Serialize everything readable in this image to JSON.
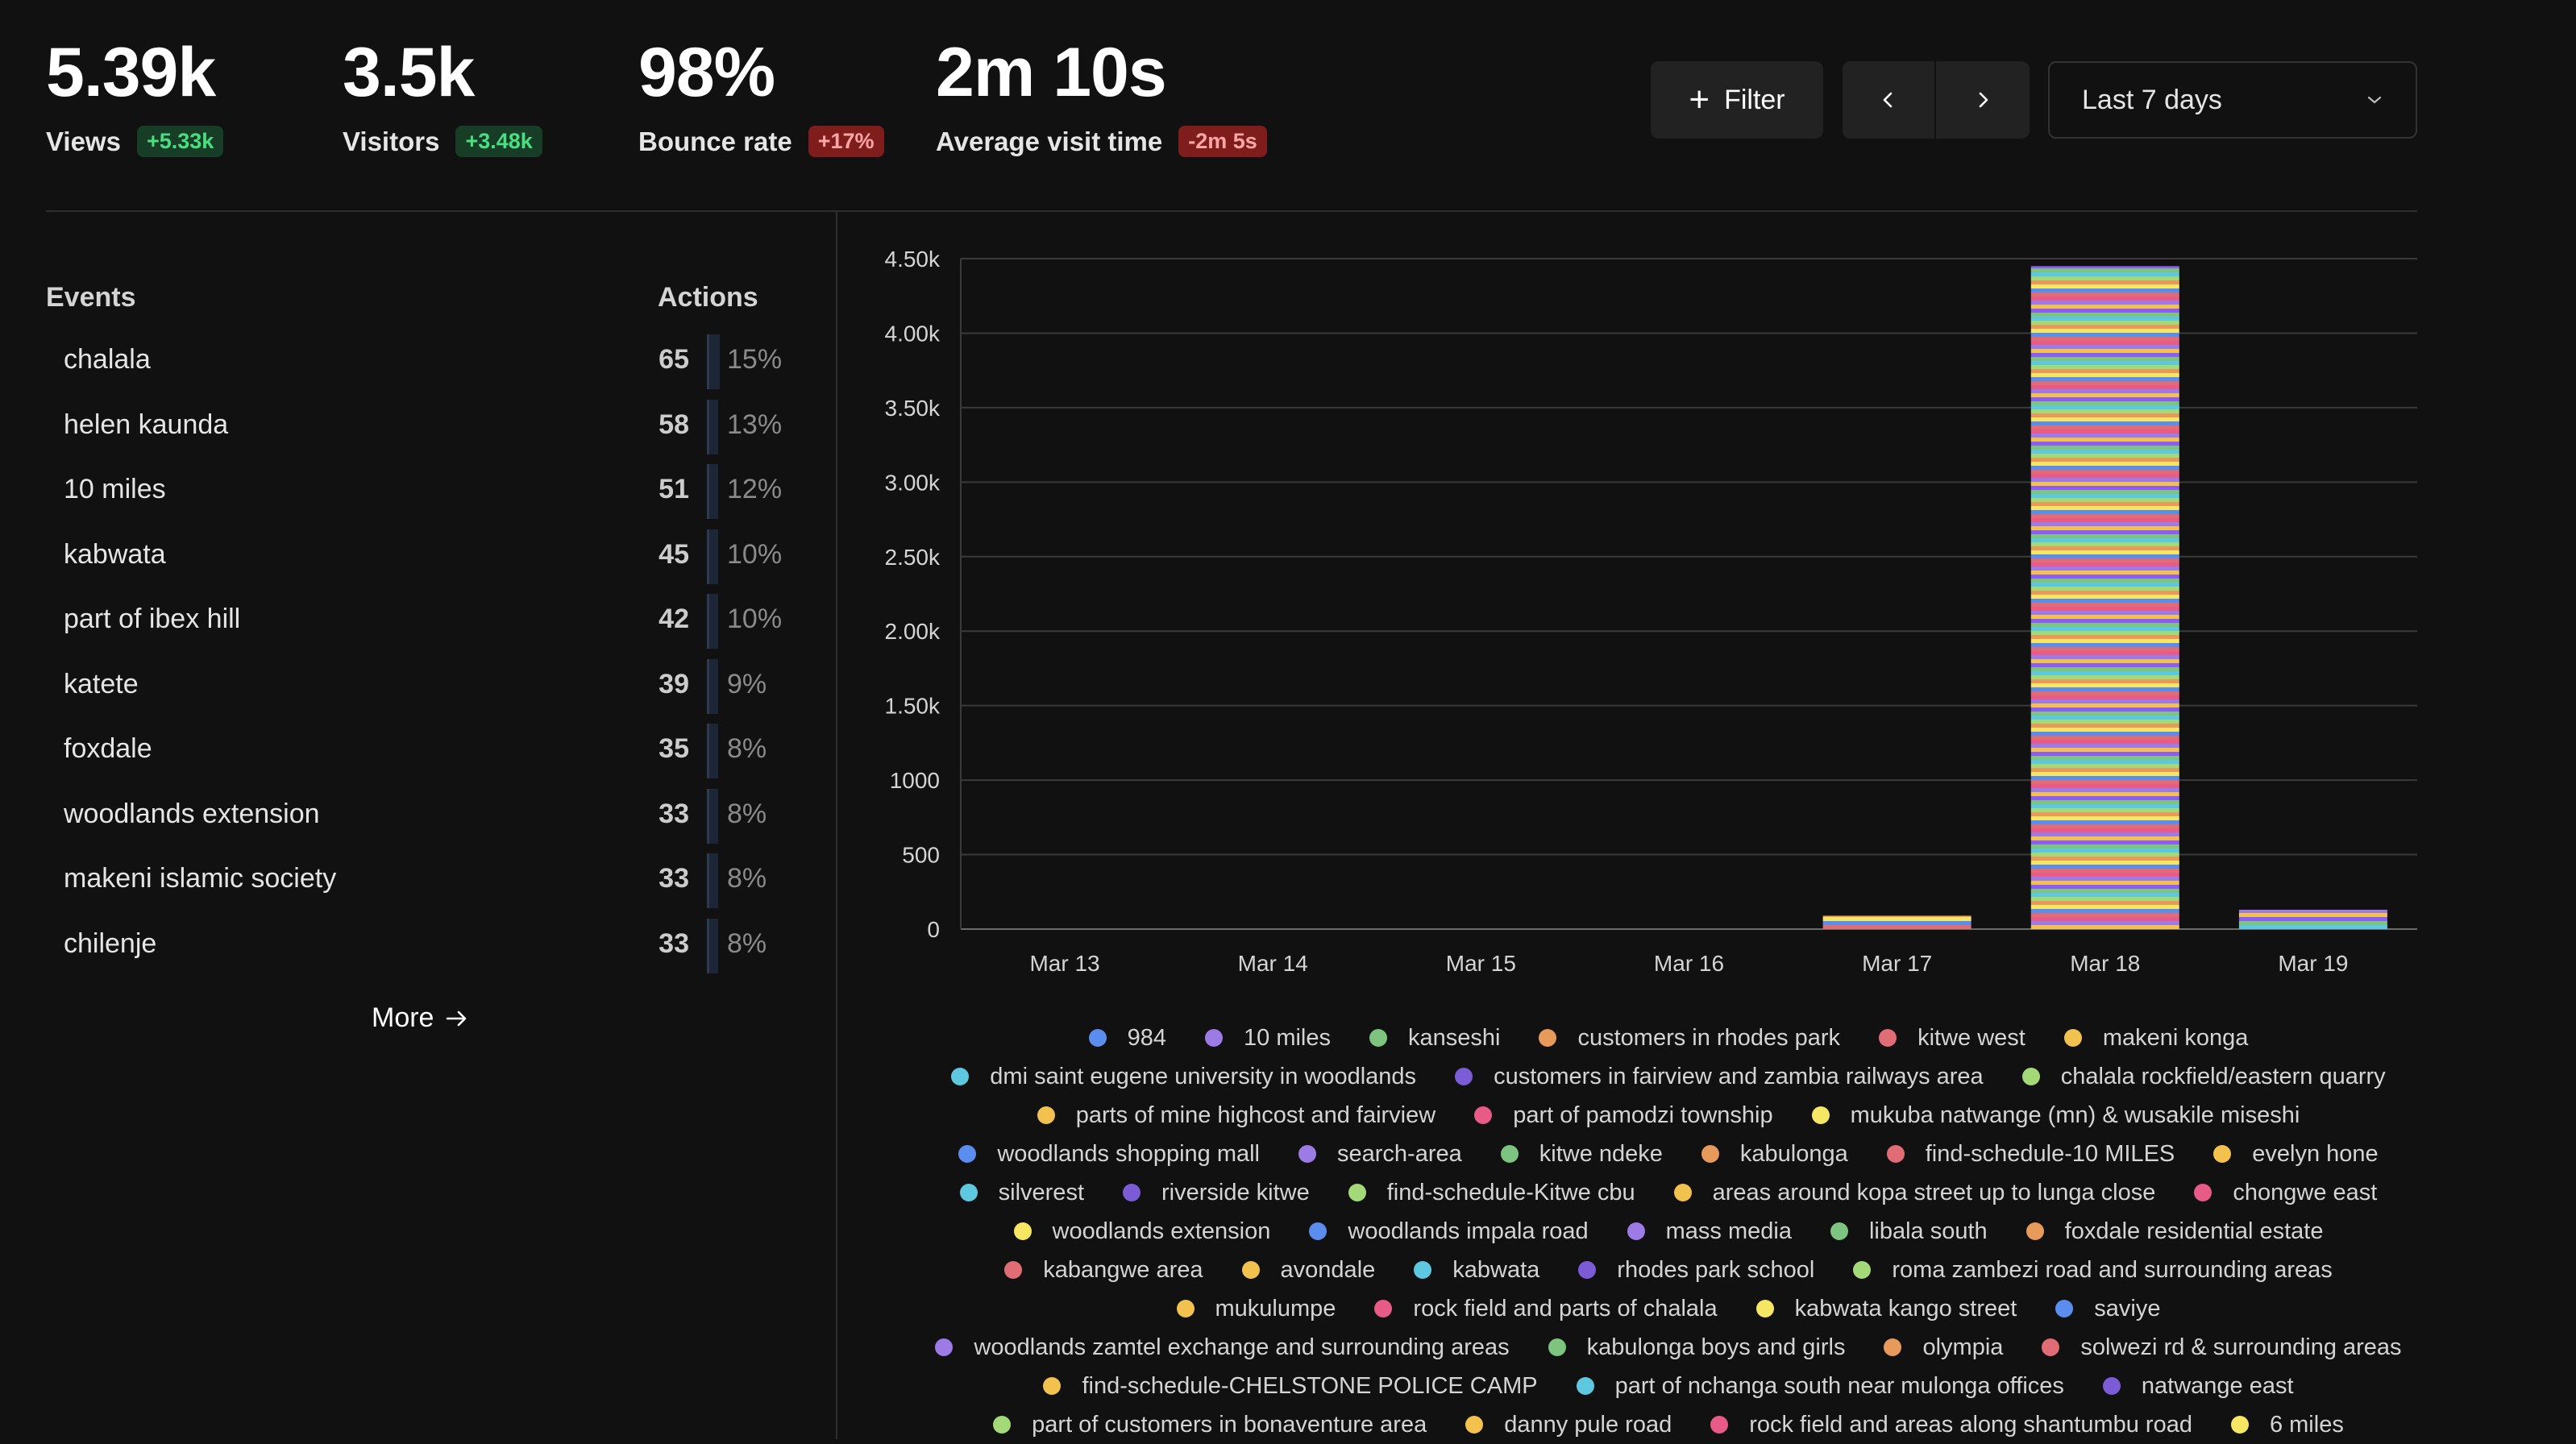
{
  "metrics": [
    {
      "value": "5.39k",
      "label": "Views",
      "badge": "+5.33k",
      "tone": "pos"
    },
    {
      "value": "3.5k",
      "label": "Visitors",
      "badge": "+3.48k",
      "tone": "pos"
    },
    {
      "value": "98%",
      "label": "Bounce rate",
      "badge": "+17%",
      "tone": "neg"
    },
    {
      "value": "2m 10s",
      "label": "Average visit time",
      "badge": "-2m 5s",
      "tone": "neg"
    }
  ],
  "controls": {
    "filter_label": "Filter",
    "range_value": "Last 7 days"
  },
  "events": {
    "header_name": "Events",
    "header_actions": "Actions",
    "rows": [
      {
        "name": "chalala",
        "count": "65",
        "pct": "15%",
        "share": 0.15
      },
      {
        "name": "helen kaunda",
        "count": "58",
        "pct": "13%",
        "share": 0.13
      },
      {
        "name": "10 miles",
        "count": "51",
        "pct": "12%",
        "share": 0.12
      },
      {
        "name": "kabwata",
        "count": "45",
        "pct": "10%",
        "share": 0.1
      },
      {
        "name": "part of ibex hill",
        "count": "42",
        "pct": "10%",
        "share": 0.1
      },
      {
        "name": "katete",
        "count": "39",
        "pct": "9%",
        "share": 0.09
      },
      {
        "name": "foxdale",
        "count": "35",
        "pct": "8%",
        "share": 0.08
      },
      {
        "name": "woodlands extension",
        "count": "33",
        "pct": "8%",
        "share": 0.08
      },
      {
        "name": "makeni islamic society",
        "count": "33",
        "pct": "8%",
        "share": 0.08
      },
      {
        "name": "chilenje",
        "count": "33",
        "pct": "8%",
        "share": 0.08
      }
    ],
    "more_label": "More"
  },
  "chart_data": {
    "type": "bar",
    "stacked": true,
    "categories": [
      "Mar 13",
      "Mar 14",
      "Mar 15",
      "Mar 16",
      "Mar 17",
      "Mar 18",
      "Mar 19"
    ],
    "values": [
      0,
      0,
      0,
      0,
      90,
      4450,
      130
    ],
    "ylim": [
      0,
      4500
    ],
    "yticks": [
      0,
      500,
      1000,
      1500,
      2000,
      2500,
      3000,
      3500,
      4000,
      4500
    ],
    "ytick_labels": [
      "0",
      "500",
      "1000",
      "1.50k",
      "2.00k",
      "2.50k",
      "3.00k",
      "3.50k",
      "4.00k",
      "4.50k"
    ],
    "grid": true,
    "legend_position": "bottom",
    "palette": [
      "#5b8def",
      "#9d7be6",
      "#7cc47f",
      "#e89a5a",
      "#e06c75",
      "#f2c14e",
      "#5ec8e0",
      "#f5e663",
      "#e85a87",
      "#8b5cf6",
      "#a3d977"
    ]
  },
  "legend_lines": [
    [
      {
        "label": "984",
        "color": "#5b8def"
      },
      {
        "label": "10 miles",
        "color": "#9d7be6"
      },
      {
        "label": "kanseshi",
        "color": "#7cc47f"
      },
      {
        "label": "customers in rhodes park",
        "color": "#e89a5a"
      },
      {
        "label": "kitwe west",
        "color": "#e06c75"
      },
      {
        "label": "makeni konga",
        "color": "#f2c14e"
      }
    ],
    [
      {
        "label": "dmi saint eugene university in woodlands",
        "color": "#5ec8e0"
      },
      {
        "label": "customers in fairview and zambia railways area",
        "color": "#7b5cd6"
      },
      {
        "label": "chalala rockfield/eastern quarry",
        "color": "#a3d977"
      }
    ],
    [
      {
        "label": "parts of mine highcost and fairview",
        "color": "#f2c14e"
      },
      {
        "label": "part of pamodzi township",
        "color": "#e85a87"
      },
      {
        "label": "mukuba natwange (mn) & wusakile miseshi",
        "color": "#f5e663"
      }
    ],
    [
      {
        "label": "woodlands shopping mall",
        "color": "#5b8def"
      },
      {
        "label": "search-area",
        "color": "#9d7be6"
      },
      {
        "label": "kitwe ndeke",
        "color": "#7cc47f"
      },
      {
        "label": "kabulonga",
        "color": "#e89a5a"
      },
      {
        "label": "find-schedule-10 MILES",
        "color": "#e06c75"
      },
      {
        "label": "evelyn hone",
        "color": "#f2c14e"
      }
    ],
    [
      {
        "label": "silverest",
        "color": "#5ec8e0"
      },
      {
        "label": "riverside kitwe",
        "color": "#7b5cd6"
      },
      {
        "label": "find-schedule-Kitwe cbu",
        "color": "#a3d977"
      },
      {
        "label": "areas around kopa street up to lunga close",
        "color": "#f2c14e"
      },
      {
        "label": "chongwe east",
        "color": "#e85a87"
      }
    ],
    [
      {
        "label": "woodlands extension",
        "color": "#f5e663"
      },
      {
        "label": "woodlands impala road",
        "color": "#5b8def"
      },
      {
        "label": "mass media",
        "color": "#9d7be6"
      },
      {
        "label": "libala south",
        "color": "#7cc47f"
      },
      {
        "label": "foxdale residential estate",
        "color": "#e89a5a"
      }
    ],
    [
      {
        "label": "kabangwe area",
        "color": "#e06c75"
      },
      {
        "label": "avondale",
        "color": "#f2c14e"
      },
      {
        "label": "kabwata",
        "color": "#5ec8e0"
      },
      {
        "label": "rhodes park school",
        "color": "#7b5cd6"
      },
      {
        "label": "roma zambezi road and surrounding areas",
        "color": "#a3d977"
      }
    ],
    [
      {
        "label": "mukulumpe",
        "color": "#f2c14e"
      },
      {
        "label": "rock field and parts of chalala",
        "color": "#e85a87"
      },
      {
        "label": "kabwata kango street",
        "color": "#f5e663"
      },
      {
        "label": "saviye",
        "color": "#5b8def"
      }
    ],
    [
      {
        "label": "woodlands zamtel exchange and surrounding areas",
        "color": "#9d7be6"
      },
      {
        "label": "kabulonga boys and girls",
        "color": "#7cc47f"
      },
      {
        "label": "olympia",
        "color": "#e89a5a"
      },
      {
        "label": "solwezi rd & surrounding areas",
        "color": "#e06c75"
      }
    ],
    [
      {
        "label": "find-schedule-CHELSTONE POLICE CAMP",
        "color": "#f2c14e"
      },
      {
        "label": "part of nchanga south near mulonga offices",
        "color": "#5ec8e0"
      },
      {
        "label": "natwange east",
        "color": "#7b5cd6"
      }
    ],
    [
      {
        "label": "part of customers in bonaventure area",
        "color": "#a3d977"
      },
      {
        "label": "danny pule road",
        "color": "#f2c14e"
      },
      {
        "label": "rock field and areas along shantumbu road",
        "color": "#e85a87"
      },
      {
        "label": "6 miles",
        "color": "#f5e663"
      }
    ]
  ]
}
